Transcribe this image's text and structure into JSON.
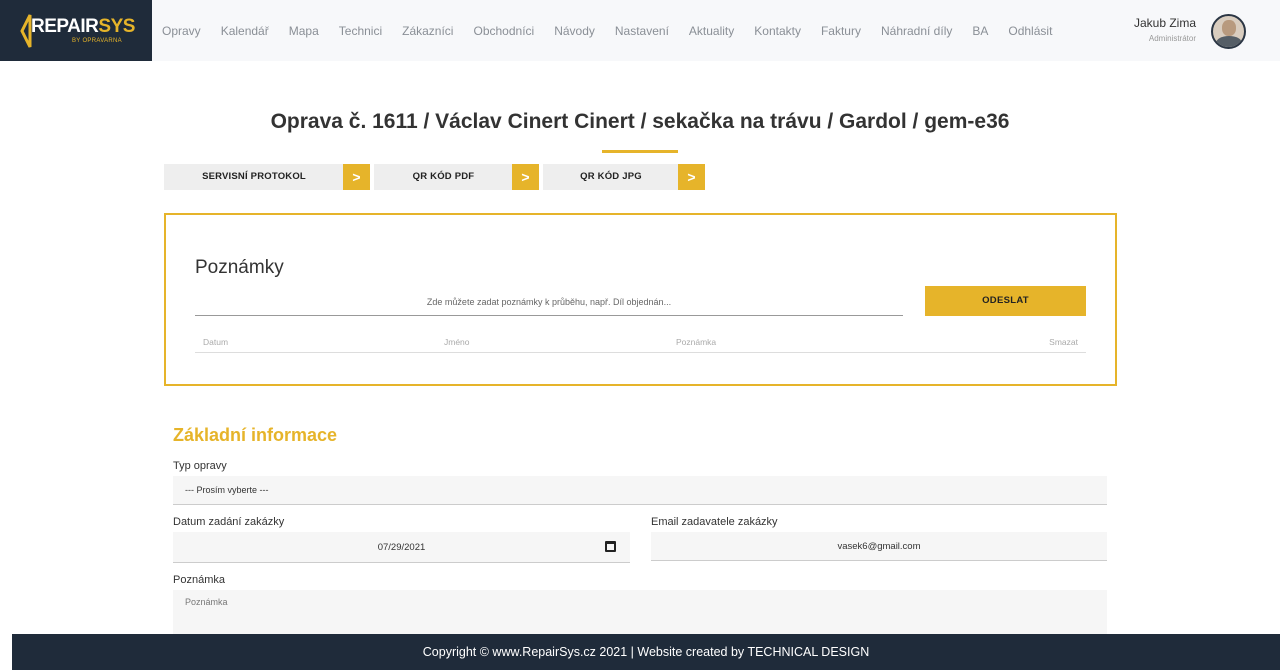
{
  "header": {
    "brand_main": "REPAIR",
    "brand_accent": "SYS",
    "brand_by": "BY OPRAVARNA",
    "nav": [
      "Opravy",
      "Kalendář",
      "Mapa",
      "Technici",
      "Zákazníci",
      "Obchodníci",
      "Návody",
      "Nastavení",
      "Aktuality",
      "Kontakty",
      "Faktury",
      "Náhradní díly",
      "BA",
      "Odhlásit"
    ],
    "user_name": "Jakub Zima",
    "user_role": "Administrátor"
  },
  "page": {
    "title": "Oprava č. 1611 / Václav Cinert Cinert / sekačka na trávu / Gardol / gem-e36",
    "tabs": [
      "SERVISNÍ PROTOKOL",
      "QR KÓD PDF",
      "QR KÓD JPG"
    ]
  },
  "notes": {
    "heading": "Poznámky",
    "placeholder": "Zde můžete zadat poznámky k průběhu, např. Díl objednán...",
    "send_label": "ODESLAT",
    "columns": [
      "Datum",
      "Jméno",
      "Poznámka",
      "Smazat"
    ]
  },
  "basic_info": {
    "heading": "Základní informace",
    "repair_type_label": "Typ opravy",
    "repair_type_value": "--- Prosím vyberte ---",
    "date_label": "Datum zadání zakázky",
    "date_value": "07/29/2021",
    "email_label": "Email zadavatele zakázky",
    "email_value": "vasek6@gmail.com",
    "note_label": "Poznámka",
    "note_placeholder": "Poznámka"
  },
  "footer": {
    "text": "Copyright © www.RepairSys.cz 2021 | Website created by",
    "credit": "TECHNICAL DESIGN"
  },
  "colors": {
    "accent": "#e6b42a",
    "dark": "#1f2b3a"
  }
}
